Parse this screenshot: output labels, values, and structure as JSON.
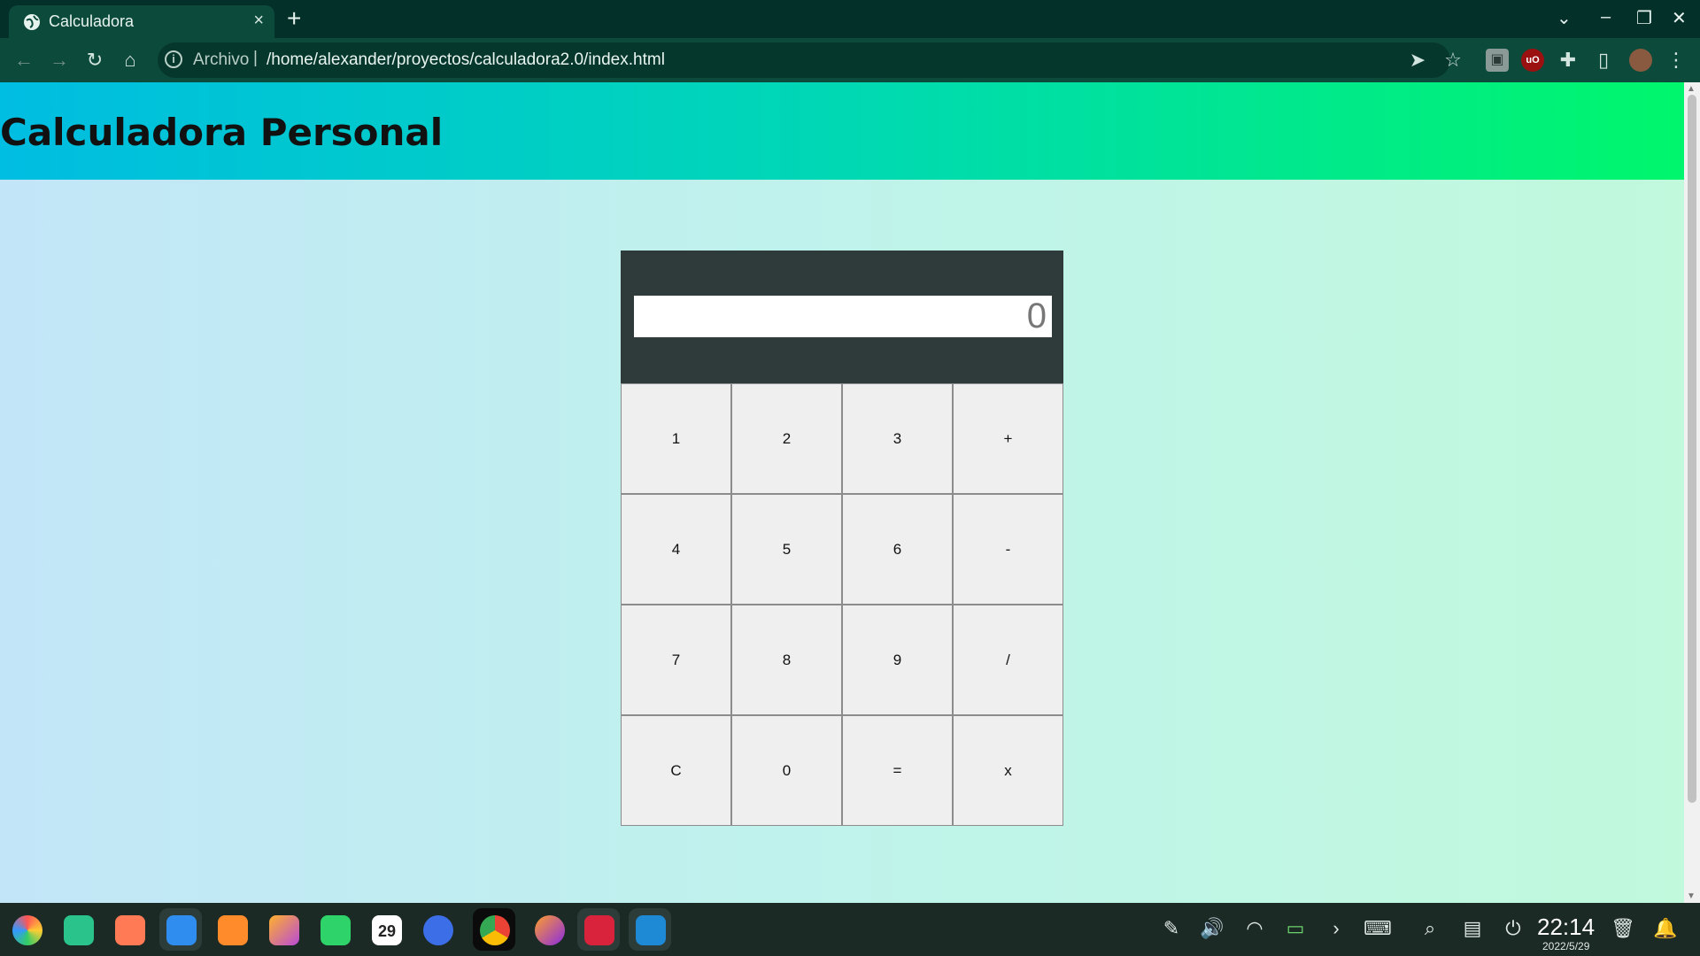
{
  "browser": {
    "tab_title": "Calculadora",
    "tab_close": "×",
    "new_tab": "+",
    "window_controls": {
      "chevron": "⌄",
      "minimize": "–",
      "restore": "❐",
      "close": "✕"
    },
    "toolbar_icons": {
      "back": "←",
      "forward": "→",
      "reload": "↻",
      "home": "⌂",
      "send": "➤",
      "star": "☆",
      "pdf": "▣",
      "ublock": "uO",
      "extensions": "✚",
      "sidebar": "▯",
      "menu": "⋮"
    },
    "omnibox": {
      "info_icon": "i",
      "scheme": "Archivo",
      "separator": "|",
      "url": "/home/alexander/proyectos/calculadora2.0/index.html"
    }
  },
  "page": {
    "title": "Calculadora Personal",
    "display_value": "0",
    "keys": [
      "1",
      "2",
      "3",
      "+",
      "4",
      "5",
      "6",
      "-",
      "7",
      "8",
      "9",
      "/",
      "C",
      "0",
      "=",
      "x"
    ]
  },
  "taskbar": {
    "clock": "22:14",
    "date": "2022/5/29",
    "calendar_day": "29"
  }
}
